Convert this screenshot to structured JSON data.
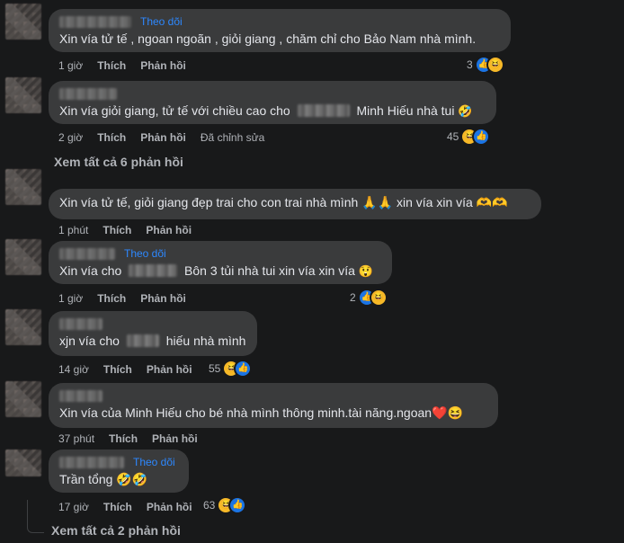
{
  "comments": [
    {
      "follow": "Theo dõi",
      "text": "Xin vía tử tế , ngoan ngoãn , giỏi giang , chăm chỉ cho Bảo Nam nhà mình.",
      "time": "1 giờ",
      "like": "Thích",
      "reply": "Phản hồi",
      "count": "3"
    },
    {
      "text_a": "Xin vía giỏi giang, tử tế với chiều cao cho",
      "text_b": "Minh Hiếu nhà tui",
      "emoji": "🤣",
      "time": "2 giờ",
      "like": "Thích",
      "reply": "Phản hồi",
      "edited": "Đã chỉnh sửa",
      "count": "45"
    },
    {
      "text": "Xin vía tử tế, giỏi giang đẹp trai cho con trai nhà mình 🙏🙏 xin vía xin vía 🫶🫶",
      "time": "1 phút",
      "like": "Thích",
      "reply": "Phản hồi"
    },
    {
      "follow": "Theo dõi",
      "text_a": "Xin vía cho",
      "text_b": "Bôn 3 tủi nhà tui xin vía xin vía",
      "emoji": "😲",
      "time": "1 giờ",
      "like": "Thích",
      "reply": "Phản hồi",
      "count": "2"
    },
    {
      "text_a": "xjn vía cho",
      "text_b": "hiếu nhà mình",
      "time": "14 giờ",
      "like": "Thích",
      "reply": "Phản hồi",
      "count": "55"
    },
    {
      "text": "Xin vía của Minh Hiếu cho bé nhà mình thông minh.tài năng.ngoan❤️😆",
      "time": "37 phút",
      "like": "Thích",
      "reply": "Phản hồi"
    },
    {
      "follow": "Theo dõi",
      "text": "Trần tổng 🤣🤣",
      "time": "17 giờ",
      "like": "Thích",
      "reply": "Phản hồi",
      "count": "63"
    }
  ],
  "view_more_1": "Xem tất cả 6 phản hồi",
  "view_more_2": "Xem tất cả 2 phản hồi",
  "reaction_icons": {
    "like": "like-icon",
    "haha": "haha-icon",
    "wow": "wow-icon"
  }
}
